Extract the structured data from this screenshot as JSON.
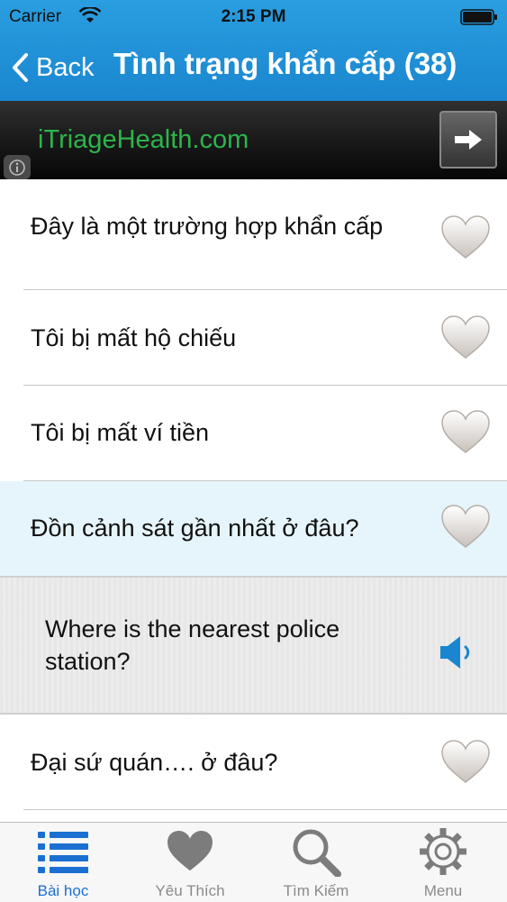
{
  "status_bar": {
    "carrier": "Carrier",
    "time": "2:15 PM"
  },
  "nav": {
    "back_label": "Back",
    "title": "Tình trạng khẩn cấp (38)"
  },
  "ad": {
    "text": "iTriageHealth.com"
  },
  "rows": [
    {
      "label": "Đây là một trường hợp khẩn cấp"
    },
    {
      "label": "Tôi bị mất hộ chiếu"
    },
    {
      "label": "Tôi bị mất ví tiền"
    },
    {
      "label": "Đồn cảnh sát gần nhất ở đâu?",
      "expanded": true,
      "translation": "Where is the nearest police station?"
    },
    {
      "label": "Đại sứ quán…. ở đâu?"
    }
  ],
  "tabs": [
    {
      "label": "Bài học",
      "icon": "list-icon",
      "active": true
    },
    {
      "label": "Yêu Thích",
      "icon": "heart-icon"
    },
    {
      "label": "Tìm Kiếm",
      "icon": "search-icon"
    },
    {
      "label": "Menu",
      "icon": "gear-icon"
    }
  ],
  "colors": {
    "header": "#1a86cf",
    "ad_text": "#2bb54a",
    "active_tab": "#1b6fd1",
    "highlight_row": "#e6f5fb"
  }
}
